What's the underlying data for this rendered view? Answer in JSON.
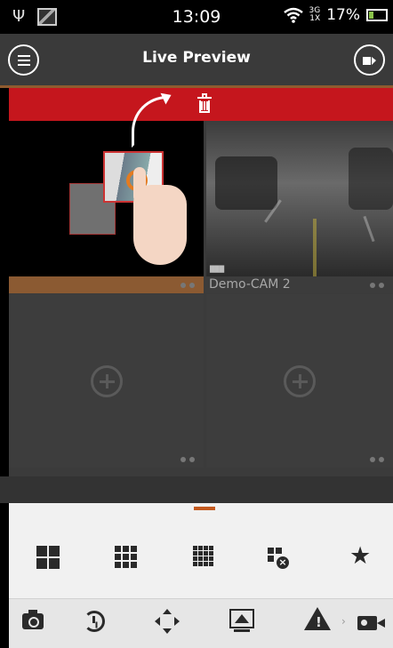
{
  "status_bar": {
    "time": "13:09",
    "network": [
      "3G",
      "1X"
    ],
    "battery": "17%",
    "icons": [
      "usb-icon",
      "image-icon",
      "wifi-icon",
      "signal-icon",
      "battery-icon"
    ]
  },
  "header": {
    "title": "Live Preview",
    "menu_icon": "menu-icon",
    "device_icon": "device-list-icon"
  },
  "delete_bar": {
    "icon": "trash-icon"
  },
  "grid": {
    "cells": [
      {
        "name": "",
        "state": "drag-hint"
      },
      {
        "name": "Demo-CAM 2",
        "state": "live"
      },
      {
        "name": "",
        "state": "empty"
      },
      {
        "name": "",
        "state": "empty"
      }
    ]
  },
  "layout_tray": {
    "page_indicator": 1,
    "items": [
      "layout-4-icon",
      "layout-9-icon",
      "layout-16-icon",
      "close-all-icon",
      "favorites-star-icon"
    ]
  },
  "toolbar": {
    "items": [
      "snapshot-camera-icon",
      "playback-icon",
      "ptz-icon",
      "screen-icon",
      "alarm-icon",
      "record-icon"
    ],
    "alarm_symbol": "!",
    "more_symbol": "›"
  },
  "colors": {
    "accent": "#c4591e",
    "delete_red": "#c5161d",
    "header": "#3a3a3a"
  }
}
